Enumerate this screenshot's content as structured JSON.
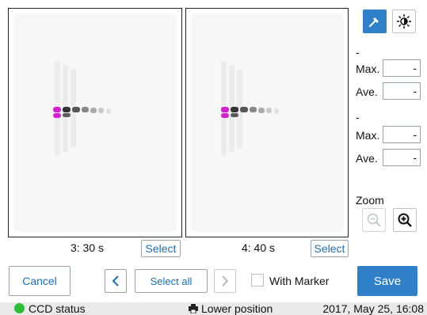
{
  "panels": [
    {
      "caption": "3: 30 s",
      "select_label": "Select"
    },
    {
      "caption": "4: 40 s",
      "select_label": "Select"
    }
  ],
  "side": {
    "group1_title": "-",
    "group2_title": "-",
    "max_label": "Max.",
    "ave_label": "Ave.",
    "max1_value": "-",
    "ave1_value": "-",
    "max2_value": "-",
    "ave2_value": "-",
    "zoom_label": "Zoom"
  },
  "actions": {
    "cancel_label": "Cancel",
    "select_all_label": "Select all",
    "with_marker_label": "With Marker",
    "save_label": "Save"
  },
  "status": {
    "ccd_label": "CCD status",
    "position_label": "Lower position",
    "datetime": "2017, May 25, 16:08"
  },
  "colors": {
    "accent": "#2f80c7",
    "status_ok": "#2ebd3b",
    "band_magenta": "#d020d0"
  },
  "icons": [
    "marker-pick-icon",
    "brightness-icon",
    "zoom-out-icon",
    "zoom-in-icon",
    "chevron-left-icon",
    "chevron-right-icon",
    "printer-icon"
  ]
}
